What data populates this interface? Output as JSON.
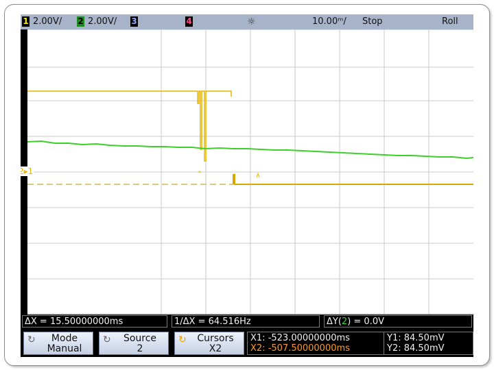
{
  "topbar": {
    "ch1_num": "1",
    "ch1_scale": "2.00V/",
    "ch2_num": "2",
    "ch2_scale": "2.00V/",
    "ch3_num": "3",
    "ch4_num": "4",
    "trigger_glyph": "☼",
    "timebase": "10.00ᵐ/",
    "run_state": "Stop",
    "mode": "Roll"
  },
  "screen": {
    "ref_marker": "2▸1",
    "trace_colors": {
      "ch1": "#e8b400",
      "ch2": "#3ccf2a"
    }
  },
  "measurements": {
    "delta_x": "ΔX = 15.50000000ms",
    "inv_delta_x": "1/ΔX = 64.516Hz",
    "delta_y_prefix": "ΔY(",
    "delta_y_channel": "2",
    "delta_y_suffix": ") = 0.0V"
  },
  "softkeys": {
    "mode": {
      "title": "Mode",
      "value": "Manual"
    },
    "source": {
      "title": "Source",
      "value": "2"
    },
    "cursors": {
      "title": "Cursors",
      "value": "X2"
    }
  },
  "cursors": {
    "x1": "X1: -523.00000000ms",
    "x2": "X2: -507.50000000ms",
    "y1": "Y1: 84.50mV",
    "y2": "Y2: 84.50mV"
  },
  "colors": {
    "topbar": "#a7b3c9",
    "ch1": "#f5ec00",
    "ch2": "#3dd33d",
    "ch4": "#ff4b8a",
    "x2_cursor": "#ff9a1f"
  }
}
